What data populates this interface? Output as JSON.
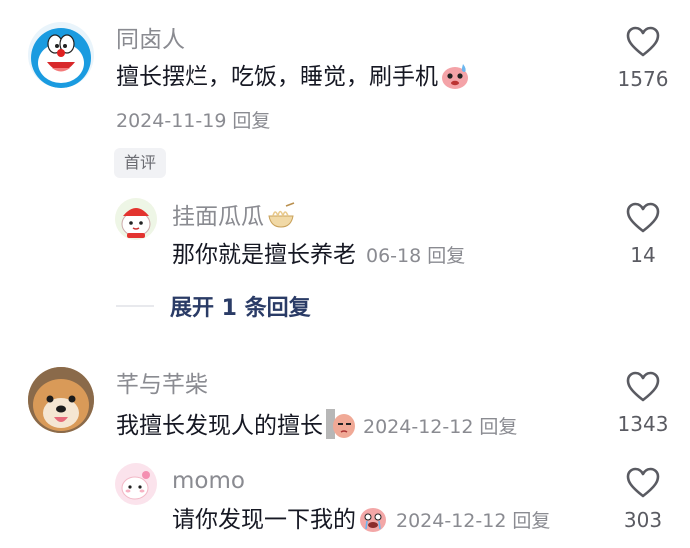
{
  "comments": [
    {
      "author": "同卤人",
      "text": "擅长摆烂，吃饭，睡觉，刷手机",
      "date": "2024-11-19",
      "reply_label": "回复",
      "like_count": "1576",
      "badge": "首评",
      "replies": [
        {
          "author": "挂面瓜瓜",
          "text": "那你就是擅长养老",
          "date": "06-18",
          "reply_label": "回复",
          "like_count": "14"
        }
      ],
      "expand_label": "展开 1 条回复"
    },
    {
      "author": "芊与芊柴",
      "text": "我擅长发现人的擅长",
      "date": "2024-12-12",
      "reply_label": "回复",
      "like_count": "1343",
      "replies": [
        {
          "author": "momo",
          "text": "请你发现一下我的",
          "date": "2024-12-12",
          "reply_label": "回复",
          "like_count": "303"
        }
      ]
    }
  ]
}
